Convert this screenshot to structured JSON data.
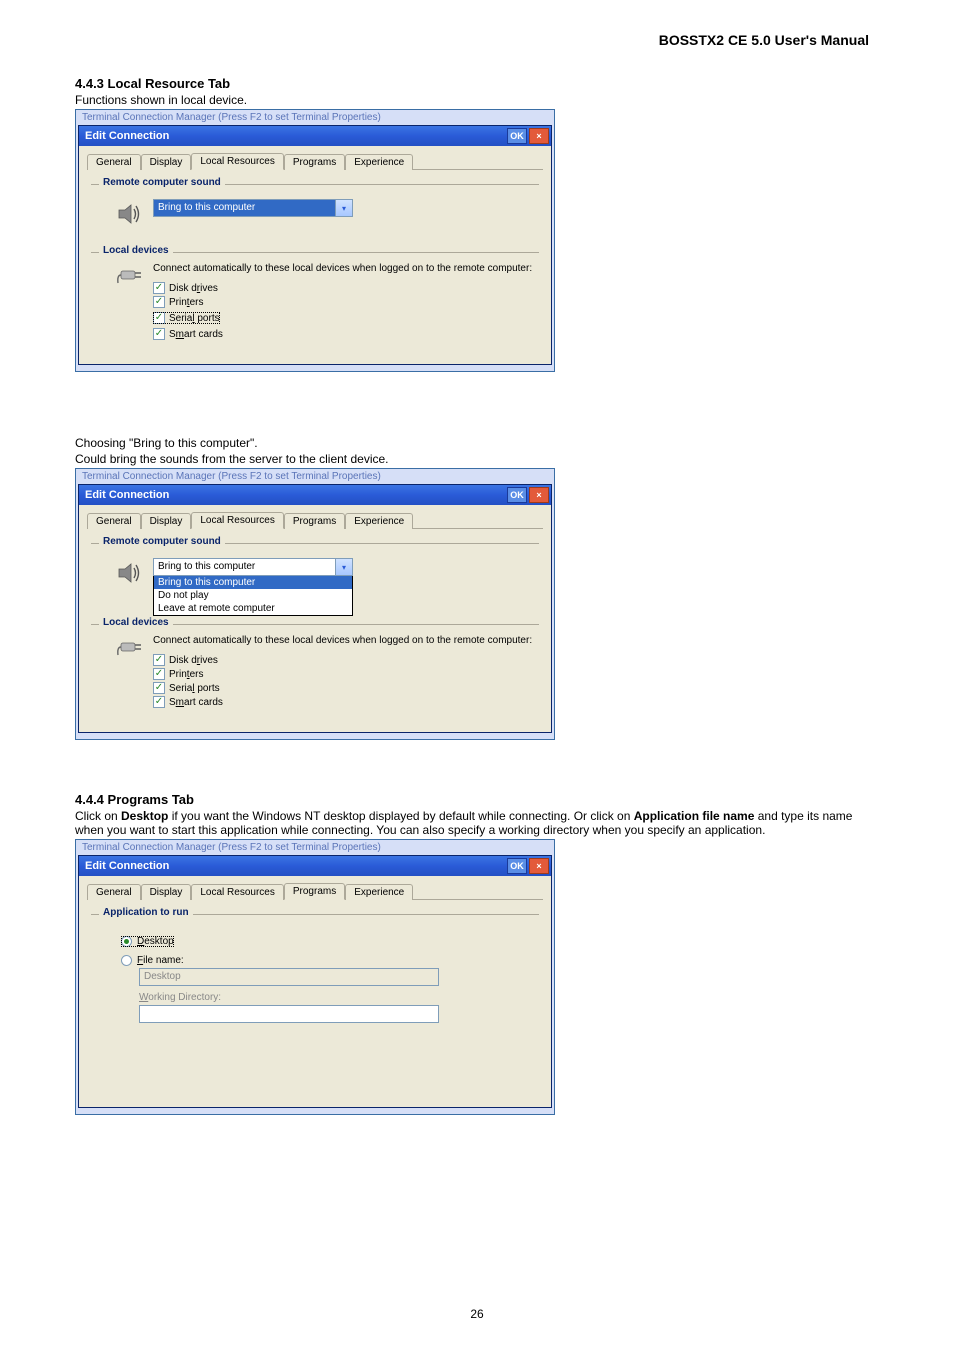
{
  "header": {
    "doc_title": "BOSSTX2 CE 5.0 User's Manual"
  },
  "page_number": "26",
  "section1": {
    "num_title": "4.4.3    Local Resource Tab",
    "subtitle": "Functions shown in local device.",
    "outer_caption": "Terminal Connection Manager (Press F2 to set Terminal Properties)",
    "dlg_title": "Edit Connection",
    "ok": "OK",
    "tabs": {
      "general": "General",
      "display": "Display",
      "local": "Local Resources",
      "programs": "Programs",
      "experience": "Experience"
    },
    "group_sound": "Remote computer sound",
    "dd_value": "Bring to this computer",
    "group_local": "Local devices",
    "local_desc": "Connect automatically to these local devices when logged on to the remote computer:",
    "chk_disk": "Disk drives",
    "chk_printers": "Printers",
    "chk_serial": "Serial ports",
    "chk_smart": "Smart cards"
  },
  "section2": {
    "line1": "Choosing \"Bring to this computer\".",
    "line2": "Could bring the sounds from the server to the client device.",
    "outer_caption": "Terminal Connection Manager (Press F2 to set Terminal Properties)",
    "dlg_title": "Edit Connection",
    "ok": "OK",
    "tabs": {
      "general": "General",
      "display": "Display",
      "local": "Local Resources",
      "programs": "Programs",
      "experience": "Experience"
    },
    "group_sound": "Remote computer sound",
    "dd_value": "Bring to this computer",
    "dd_options": {
      "o1": "Bring to this computer",
      "o2": "Do not play",
      "o3": "Leave at remote computer"
    },
    "group_local": "Local devices",
    "local_desc": "Connect automatically to these local devices when logged on to the remote computer:",
    "chk_disk": "Disk drives",
    "chk_printers": "Printers",
    "chk_serial": "Serial ports",
    "chk_smart": "Smart cards"
  },
  "section3": {
    "num_title": "4.4.4    Programs Tab",
    "para_pre": "Click on ",
    "para_b1": "Desktop",
    "para_mid1": " if you want the Windows NT desktop displayed by default while connecting. Or click on ",
    "para_b2": "Application file name",
    "para_mid2": " and type its name when you want to start this application while connecting. You can also specify a working directory when you specify an application.",
    "outer_caption": "Terminal Connection Manager (Press F2 to set Terminal Properties)",
    "dlg_title": "Edit Connection",
    "ok": "OK",
    "tabs": {
      "general": "General",
      "display": "Display",
      "local": "Local Resources",
      "programs": "Programs",
      "experience": "Experience"
    },
    "group_app": "Application to run",
    "radio_desktop": "Desktop",
    "radio_file": "File name:",
    "input_filename_value": "Desktop",
    "label_workdir": "Working Directory:",
    "input_workdir_value": ""
  }
}
